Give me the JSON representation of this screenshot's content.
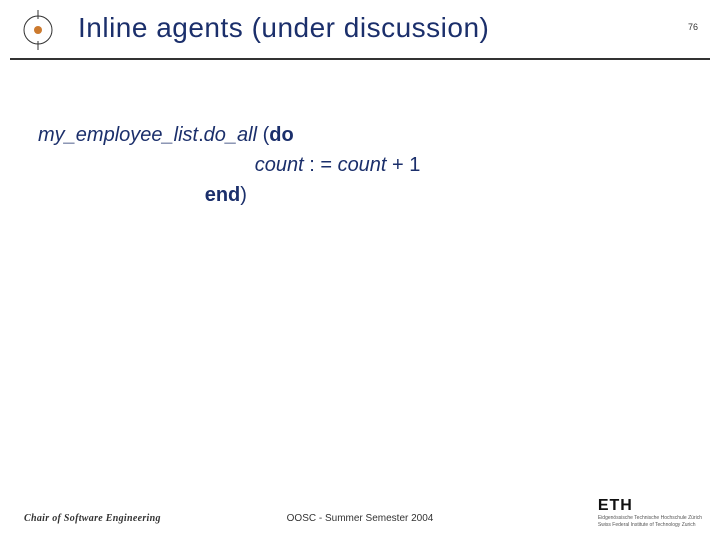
{
  "header": {
    "title": "Inline agents (under discussion)",
    "page_number": "76"
  },
  "code": {
    "prefix_italic": "my_employee_list",
    "dot": ".",
    "method_italic": "do_all ",
    "open_paren": "(",
    "do_kw": "do",
    "line2_indent": "                                       ",
    "assign_left": "count ",
    "assign_op": ": = ",
    "assign_right_italic": "count ",
    "assign_tail": "+ 1",
    "line3_indent": "                              ",
    "end_kw": "end",
    "close_paren": ")"
  },
  "footer": {
    "left": "Chair of Software Engineering",
    "center": "OOSC - Summer Semester 2004",
    "logo_main": "ETH",
    "logo_sub1": "Eidgenössische Technische Hochschule Zürich",
    "logo_sub2": "Swiss Federal Institute of Technology Zurich"
  }
}
